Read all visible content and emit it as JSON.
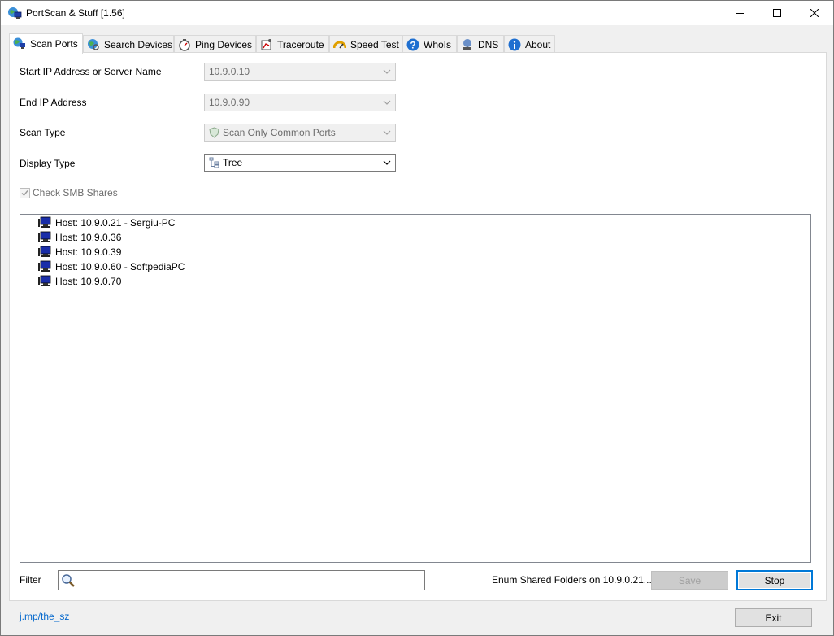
{
  "window": {
    "title": "PortScan & Stuff [1.56]"
  },
  "tabs": [
    {
      "label": "Scan Ports",
      "icon": "globe-network-icon",
      "active": true
    },
    {
      "label": "Search Devices",
      "icon": "globe-search-icon"
    },
    {
      "label": "Ping Devices",
      "icon": "stopwatch-icon"
    },
    {
      "label": "Traceroute",
      "icon": "route-icon"
    },
    {
      "label": "Speed Test",
      "icon": "speedometer-icon"
    },
    {
      "label": "WhoIs",
      "icon": "question-icon"
    },
    {
      "label": "DNS",
      "icon": "dns-server-icon"
    },
    {
      "label": "About",
      "icon": "info-icon"
    }
  ],
  "form": {
    "start_ip_label": "Start IP Address or Server Name",
    "start_ip_value": "10.9.0.10",
    "end_ip_label": "End IP Address",
    "end_ip_value": "10.9.0.90",
    "scan_type_label": "Scan Type",
    "scan_type_value": "Scan Only Common Ports",
    "display_type_label": "Display Type",
    "display_type_value": "Tree",
    "check_smb_label": "Check SMB Shares",
    "check_smb_checked": true
  },
  "results": [
    {
      "label": "Host: 10.9.0.21 - Sergiu-PC"
    },
    {
      "label": "Host: 10.9.0.36"
    },
    {
      "label": "Host: 10.9.0.39"
    },
    {
      "label": "Host: 10.9.0.60 - SoftpediaPC"
    },
    {
      "label": "Host: 10.9.0.70"
    }
  ],
  "filter": {
    "label": "Filter",
    "value": ""
  },
  "status": "Enum Shared Folders on 10.9.0.21...",
  "buttons": {
    "save": "Save",
    "stop": "Stop",
    "exit": "Exit"
  },
  "footer": {
    "link": "j.mp/the_sz"
  },
  "colors": {
    "accent": "#0078d7",
    "link": "#0066cc",
    "disabled_text": "#6d6d6d"
  }
}
